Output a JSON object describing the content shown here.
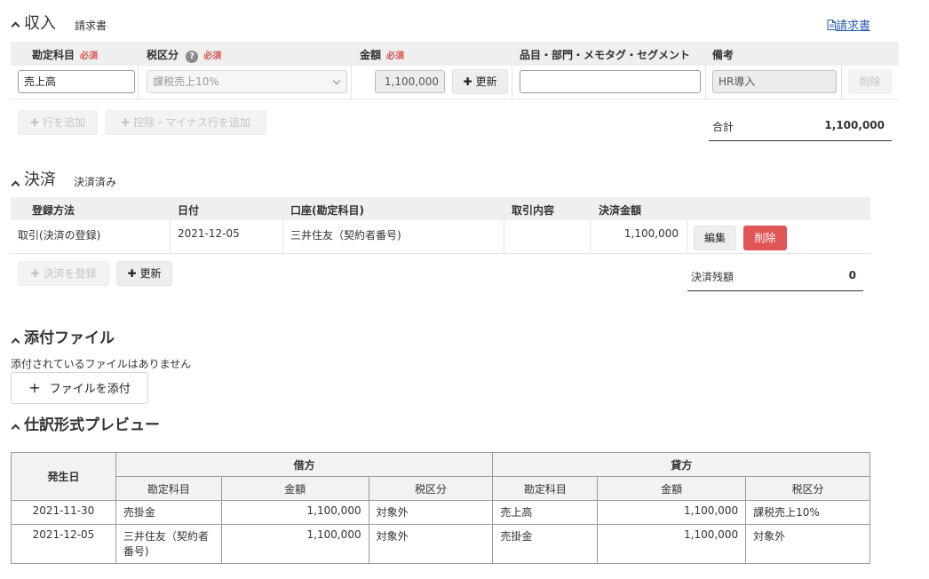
{
  "income": {
    "title": "収入",
    "subtitle": "請求書",
    "invoice_link": "請求書",
    "headers": {
      "account": "勘定科目",
      "required": "必須",
      "tax": "税区分",
      "amount": "金額",
      "segment": "品目・部門・メモタグ・セグメント",
      "memo": "備考"
    },
    "row": {
      "account": "売上高",
      "tax": "課税売上10%",
      "amount": "1,100,000",
      "update_label": "更新",
      "segment": "",
      "memo": "HR導入",
      "delete_label": "削除"
    },
    "add_row_label": "行を追加",
    "add_minus_row_label": "控除・マイナス行を追加",
    "total_label": "合計",
    "total_value": "1,100,000"
  },
  "settlement": {
    "title": "決済",
    "subtitle": "決済済み",
    "headers": {
      "method": "登録方法",
      "date": "日付",
      "account": "口座(勘定科目)",
      "content": "取引内容",
      "amount": "決済金額"
    },
    "row": {
      "method": "取引(決済の登録)",
      "date": "2021-12-05",
      "account": "三井住友（契約者番号)",
      "content": "",
      "amount": "1,100,000",
      "edit_label": "編集",
      "delete_label": "削除"
    },
    "register_label": "決済を登録",
    "update_label": "更新",
    "balance_label": "決済残額",
    "balance_value": "0"
  },
  "attachments": {
    "title": "添付ファイル",
    "empty_text": "添付されているファイルはありません",
    "attach_label": "ファイルを添付"
  },
  "preview": {
    "title": "仕訳形式プレビュー",
    "header_date": "発生日",
    "header_debit": "借方",
    "header_credit": "貸方",
    "sub_account": "勘定科目",
    "sub_amount": "金額",
    "sub_tax": "税区分",
    "rows": [
      {
        "date": "2021-11-30",
        "debit_account": "売掛金",
        "debit_amount": "1,100,000",
        "debit_tax": "対象外",
        "credit_account": "売上高",
        "credit_amount": "1,100,000",
        "credit_tax": "課税売上10%"
      },
      {
        "date": "2021-12-05",
        "debit_account": "三井住友（契約者番号)",
        "debit_amount": "1,100,000",
        "debit_tax": "対象外",
        "credit_account": "売掛金",
        "credit_amount": "1,100,000",
        "credit_tax": "対象外"
      }
    ]
  }
}
